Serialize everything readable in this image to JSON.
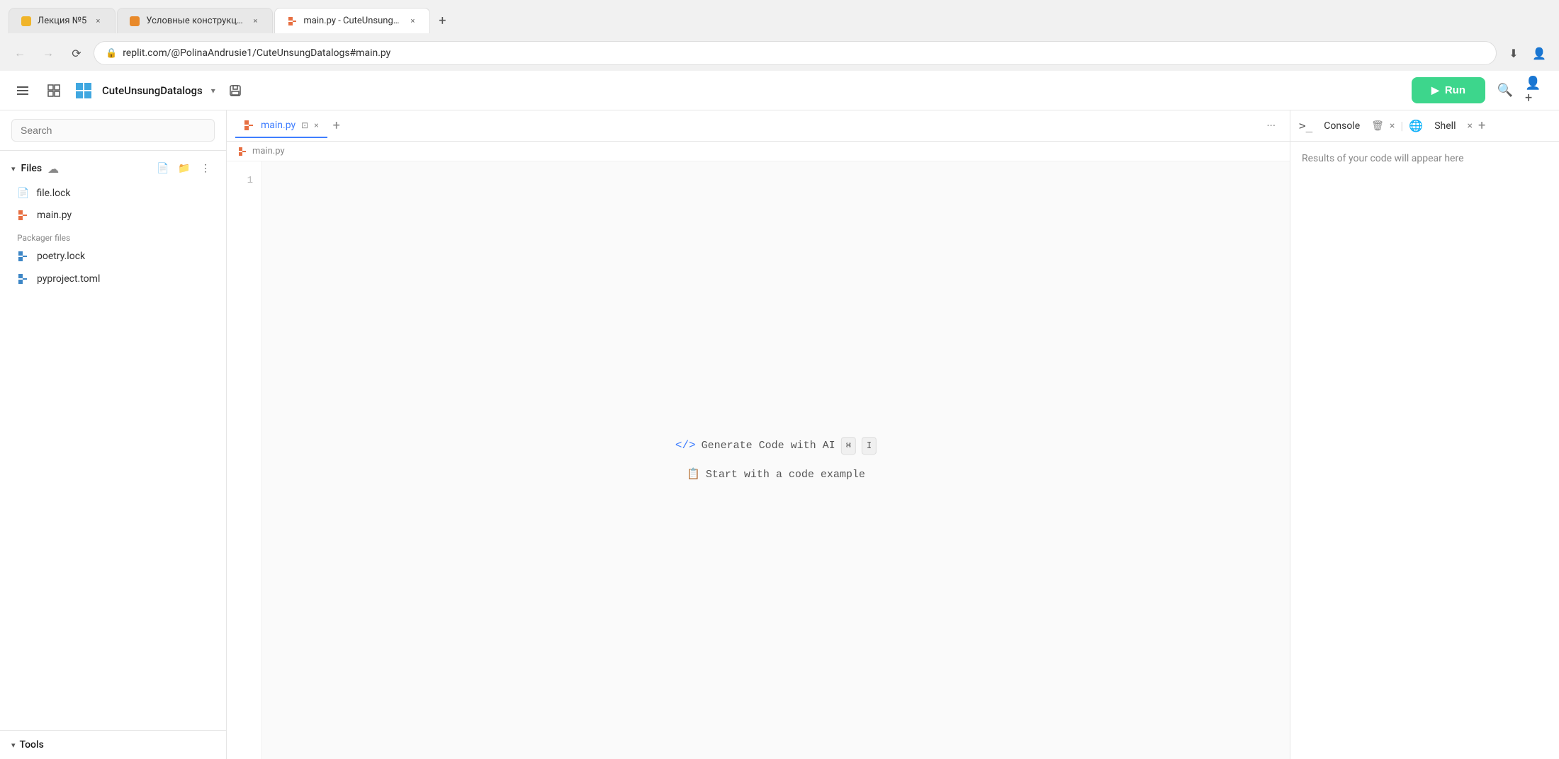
{
  "browser": {
    "tabs": [
      {
        "id": "tab1",
        "title": "Лекция №5",
        "active": false,
        "favicon_color": "#f0b429"
      },
      {
        "id": "tab2",
        "title": "Условные конструкции - Go...",
        "active": false,
        "favicon_color": "#e8892a"
      },
      {
        "id": "tab3",
        "title": "main.py - CuteUnsungDatalog...",
        "active": true,
        "favicon": "replit"
      }
    ],
    "new_tab_label": "+",
    "address": "replit.com/@PolinaAndrusie1/CuteUnsungDatalogs#main.py",
    "lock_icon": "🔒"
  },
  "header": {
    "project_name": "CuteUnsungDatalogs",
    "run_button_label": "Run",
    "run_button_icon": "▶"
  },
  "sidebar": {
    "search_placeholder": "Search",
    "files_section_title": "Files",
    "files": [
      {
        "name": "file.lock",
        "icon": "file",
        "type": "plain"
      },
      {
        "name": "main.py",
        "icon": "replit",
        "type": "replit"
      }
    ],
    "packager_label": "Packager files",
    "packager_files": [
      {
        "name": "poetry.lock",
        "icon": "replit",
        "type": "replit"
      },
      {
        "name": "pyproject.toml",
        "icon": "replit",
        "type": "replit"
      }
    ],
    "tools_label": "Tools"
  },
  "editor": {
    "tabs": [
      {
        "id": "main-py",
        "label": "main.py",
        "active": true
      }
    ],
    "breadcrumb": "main.py",
    "line_numbers": [
      "1"
    ],
    "ai_hint": {
      "generate_label": "Generate Code with AI",
      "kbd_cmd": "⌘",
      "kbd_i": "I",
      "example_label": "Start with a code example",
      "example_icon": "📄"
    }
  },
  "console": {
    "console_label": "Console",
    "clear_icon": "🗑",
    "close_icon": "×",
    "shell_label": "Shell",
    "shell_icon": "🌐",
    "add_icon": "+",
    "empty_message": "Results of your code will appear here"
  }
}
